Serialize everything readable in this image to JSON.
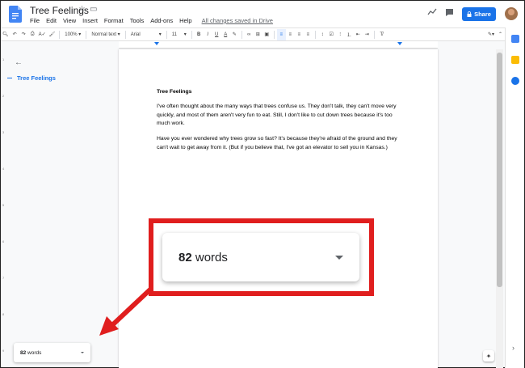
{
  "app": {
    "title": "Tree Feelings",
    "star_icon": "☆",
    "folder_icon": "▭",
    "menu": [
      "File",
      "Edit",
      "View",
      "Insert",
      "Format",
      "Tools",
      "Add-ons",
      "Help"
    ],
    "saved_status": "All changes saved in Drive",
    "share_label": "Share"
  },
  "toolbar": {
    "zoom": "100%",
    "style": "Normal text",
    "font": "Arial",
    "size": "11"
  },
  "outline": {
    "back_icon": "←",
    "items": [
      "Tree Feelings"
    ]
  },
  "document": {
    "heading": "Tree Feelings",
    "paragraphs": [
      "I've often thought about the many ways that trees confuse us. They don't talk, they can't move very quickly, and most of them aren't very fun to eat. Still, I don't like to cut down trees because it's too much work.",
      "Have you ever wondered why trees grow so fast? It's because they're afraid of the ground and they can't wait to get away from it. (But if you believe that, I've got an elevator to sell you in Kansas.)"
    ]
  },
  "word_count": {
    "number": "82",
    "unit": "words"
  },
  "colors": {
    "accent": "#1a73e8",
    "highlight": "#e01e1e"
  }
}
